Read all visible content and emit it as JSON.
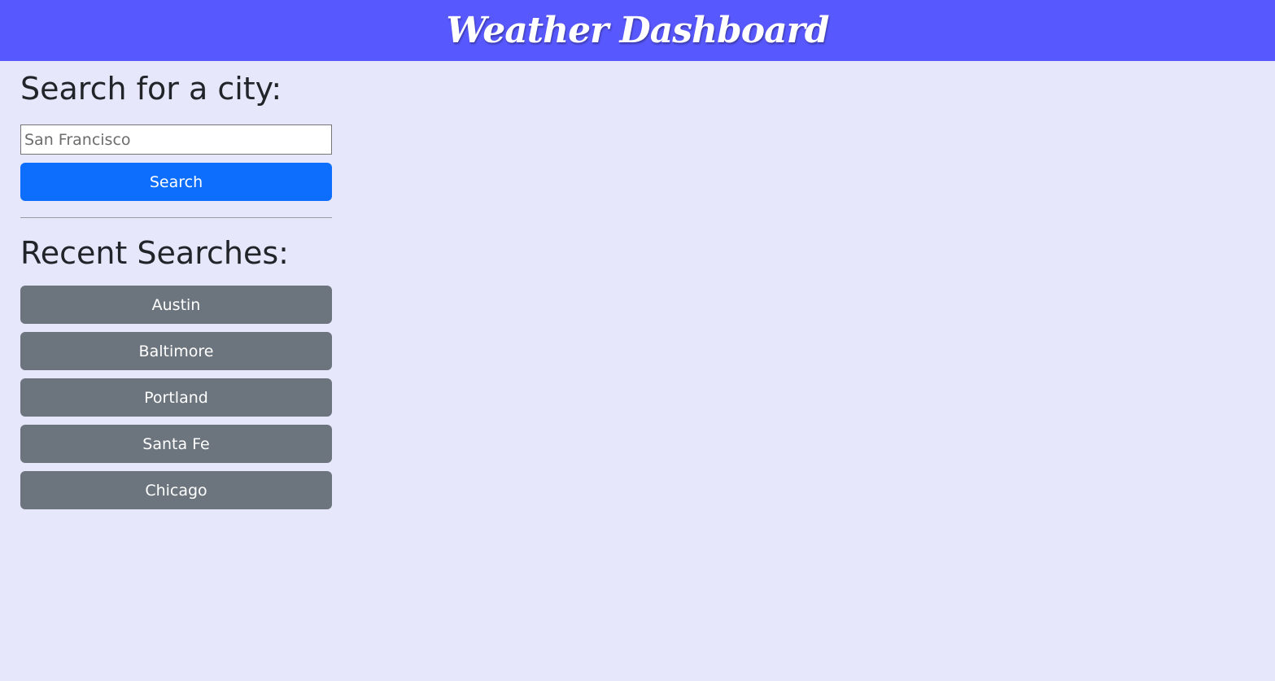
{
  "header": {
    "title": "Weather Dashboard"
  },
  "search": {
    "title": "Search for a city:",
    "placeholder": "San Francisco",
    "value": "",
    "button_label": "Search"
  },
  "recent": {
    "title": "Recent Searches:",
    "items": [
      {
        "label": "Austin"
      },
      {
        "label": "Baltimore"
      },
      {
        "label": "Portland"
      },
      {
        "label": "Santa Fe"
      },
      {
        "label": "Chicago"
      }
    ]
  },
  "colors": {
    "header_bg": "#5858ff",
    "page_bg": "#e7e7fb",
    "primary": "#0d6efd",
    "secondary": "#6c757d"
  }
}
